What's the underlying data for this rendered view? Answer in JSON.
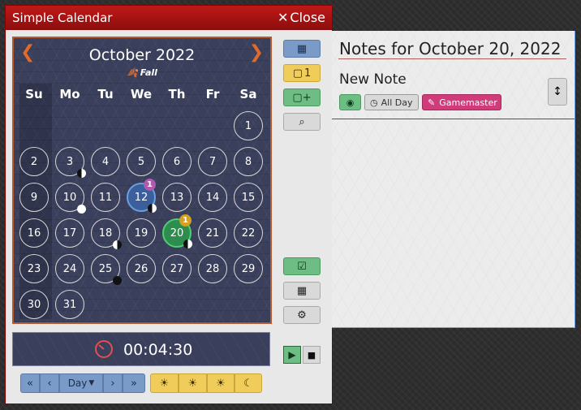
{
  "window": {
    "title": "Simple Calendar",
    "close_label": "Close"
  },
  "calendar": {
    "month_title": "October 2022",
    "season": "Fall",
    "weekdays": [
      "Su",
      "Mo",
      "Tu",
      "We",
      "Th",
      "Fr",
      "Sa"
    ],
    "days": [
      {
        "n": "1"
      },
      {
        "n": "2"
      },
      {
        "n": "3",
        "moon": "first-quarter"
      },
      {
        "n": "4"
      },
      {
        "n": "5"
      },
      {
        "n": "6"
      },
      {
        "n": "7"
      },
      {
        "n": "8"
      },
      {
        "n": "9"
      },
      {
        "n": "10",
        "moon": "full"
      },
      {
        "n": "11"
      },
      {
        "n": "12",
        "state": "current",
        "notes": "1",
        "moon": "waning-gibbous"
      },
      {
        "n": "13"
      },
      {
        "n": "14"
      },
      {
        "n": "15"
      },
      {
        "n": "16"
      },
      {
        "n": "17"
      },
      {
        "n": "18",
        "moon": "third-quarter"
      },
      {
        "n": "19"
      },
      {
        "n": "20",
        "state": "selected",
        "notes": "1",
        "moon": "waning-crescent"
      },
      {
        "n": "21"
      },
      {
        "n": "22"
      },
      {
        "n": "23"
      },
      {
        "n": "24"
      },
      {
        "n": "25",
        "moon": "new"
      },
      {
        "n": "26"
      },
      {
        "n": "27"
      },
      {
        "n": "28"
      },
      {
        "n": "29"
      },
      {
        "n": "30"
      },
      {
        "n": "31"
      }
    ],
    "colors": {
      "panel": "#3a3f5c",
      "accent": "#e06a2a",
      "selected": "#2f8c4f",
      "current": "#3b5f9c"
    }
  },
  "timer": {
    "time": "00:04:30"
  },
  "controls": {
    "rewind_icon": "double-chevron-left-icon",
    "back_icon": "chevron-left-icon",
    "unit_label": "Day",
    "forward_icon": "chevron-right-icon",
    "fastforward_icon": "double-chevron-right-icon",
    "time_of_day_icons": [
      "sunrise-icon",
      "midday-icon",
      "sunset-icon",
      "midnight-icon"
    ]
  },
  "sidebar": {
    "calendar_icon": "calendar-icon",
    "notes_count": "1",
    "add_note_icon": "add-note-icon",
    "search_icon": "search-icon",
    "today_icon": "calendar-check-icon",
    "set_date_icon": "calendar-icon",
    "configure_icon": "gear-icon",
    "play_icon": "play-icon",
    "stop_icon": "stop-icon"
  },
  "notes": {
    "title": "Notes for October 20, 2022",
    "note": {
      "title": "New Note",
      "visibility_icon": "eye-icon",
      "time_label": "All Day",
      "author_label": "Gamemaster"
    }
  }
}
